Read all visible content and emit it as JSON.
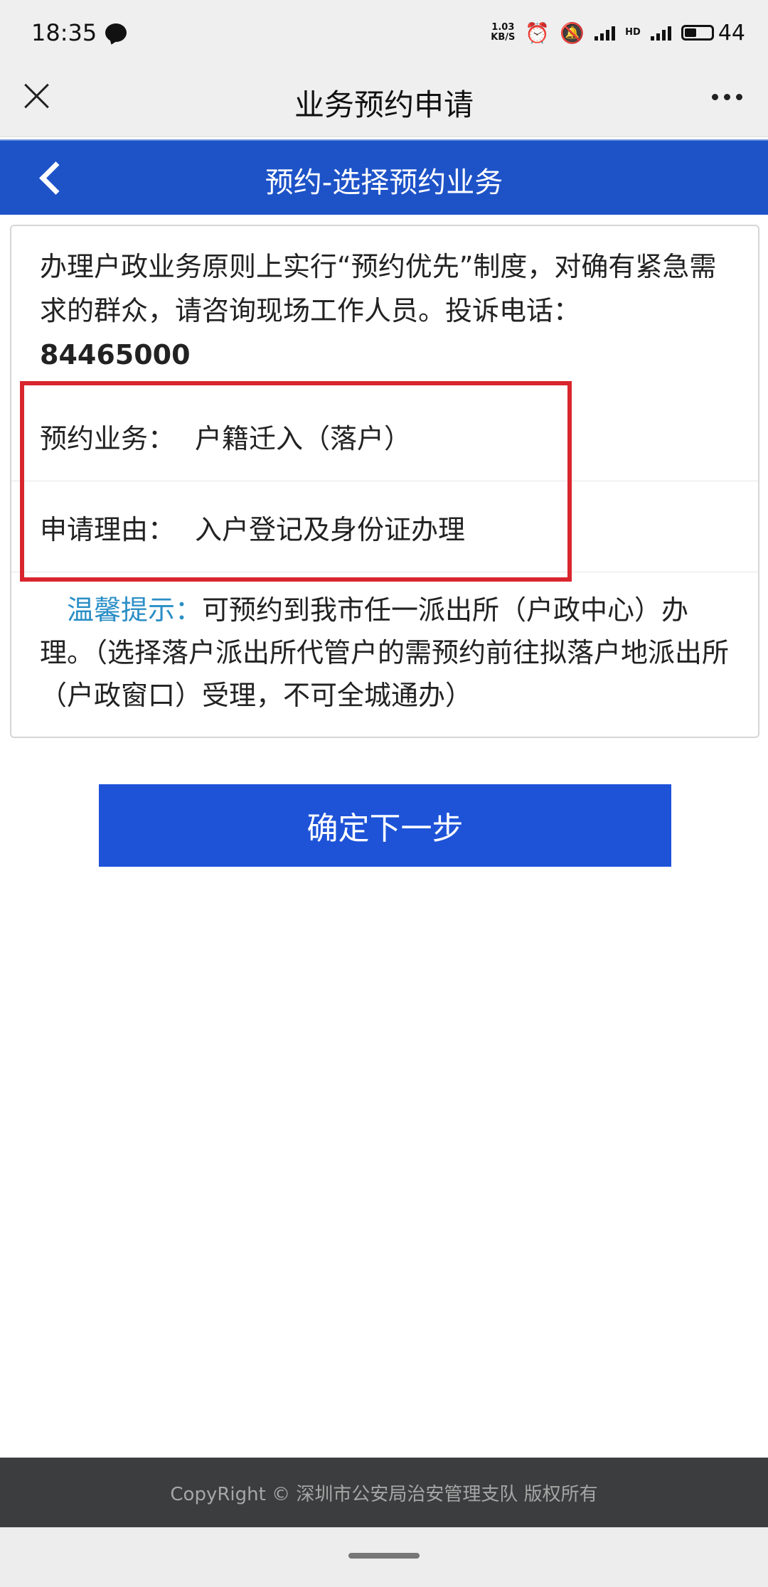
{
  "status_bar": {
    "time": "18:35",
    "net_speed_value": "1.03",
    "net_speed_unit": "KB/S",
    "network_type": "4G",
    "hd_label": "HD",
    "battery_level": "44"
  },
  "title_bar": {
    "title": "业务预约申请"
  },
  "header": {
    "title": "预约-选择预约业务"
  },
  "notice": {
    "text": "办理户政业务原则上实行“预约优先”制度，对确有紧急需求的群众，请咨询现场工作人员。投诉电话：",
    "phone": "84465000"
  },
  "fields": [
    {
      "label": "预约业务：",
      "value": "户籍迁入（落户）"
    },
    {
      "label": "申请理由：",
      "value": "入户登记及身份证办理"
    }
  ],
  "tip": {
    "label": "温馨提示：",
    "text": "可预约到我市任一派出所（户政中心）办理。（选择落户派出所代管户的需预约前往拟落户地派出所（户政窗口）受理，不可全城通办）"
  },
  "buttons": {
    "next": "确定下一步"
  },
  "footer": {
    "copyright": "CopyRight © 深圳市公安局治安管理支队 版权所有"
  },
  "colors": {
    "header_blue": "#1e53c8",
    "button_blue": "#1e53d8",
    "highlight_red": "#d9262e",
    "tip_blue": "#2a8ec6",
    "footer_bg": "#3c3d3e"
  }
}
